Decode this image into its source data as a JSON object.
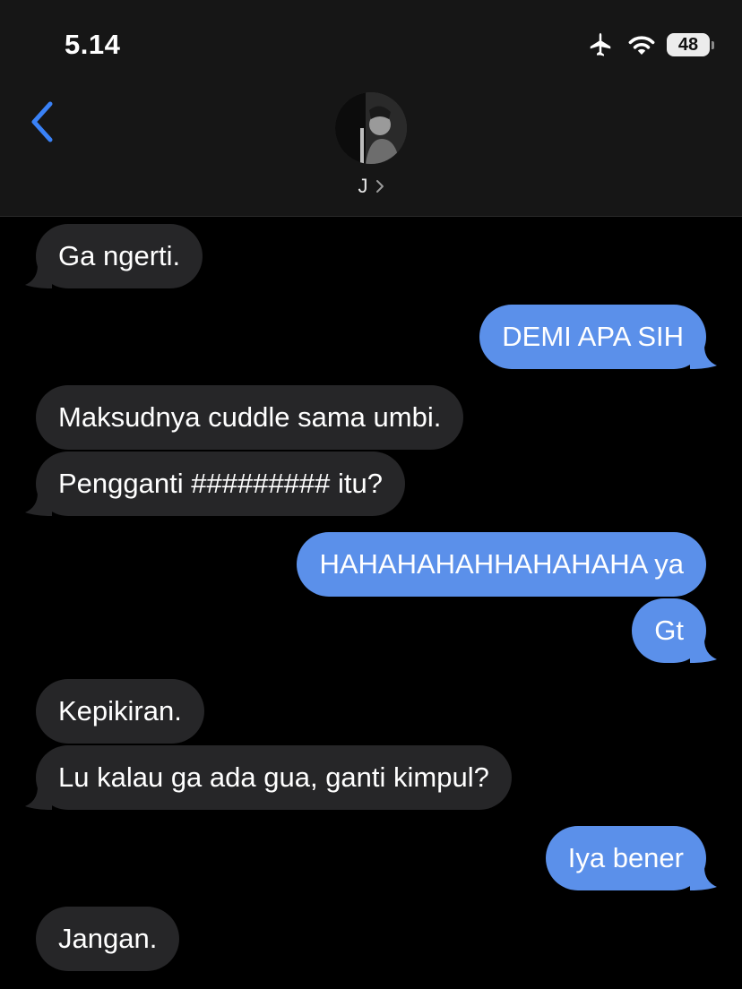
{
  "status_bar": {
    "time": "5.14",
    "battery": "48",
    "icons": [
      "airplane-icon",
      "wifi-icon",
      "battery-icon"
    ]
  },
  "header": {
    "contact_name": "J",
    "back_icon": "chevron-left-icon",
    "name_chevron": "chevron-right-icon"
  },
  "messages": [
    {
      "text": "Ga ngerti.",
      "from": "them"
    },
    {
      "text": "DEMI APA SIH",
      "from": "me"
    },
    {
      "text": "Maksudnya cuddle sama umbi.",
      "from": "them"
    },
    {
      "text": "Pengganti ######### itu?",
      "from": "them"
    },
    {
      "text": "HAHAHAHAHHAHAHAHA ya",
      "from": "me"
    },
    {
      "text": "Gt",
      "from": "me"
    },
    {
      "text": "Kepikiran.",
      "from": "them"
    },
    {
      "text": "Lu kalau ga ada gua, ganti kimpul?",
      "from": "them"
    },
    {
      "text": "Iya bener",
      "from": "me"
    },
    {
      "text": "Jangan.",
      "from": "them"
    }
  ],
  "colors": {
    "background": "#000000",
    "header_bg": "#161616",
    "received_bubble": "#262628",
    "sent_bubble": "#5b90ea",
    "accent": "#3a82f7"
  }
}
